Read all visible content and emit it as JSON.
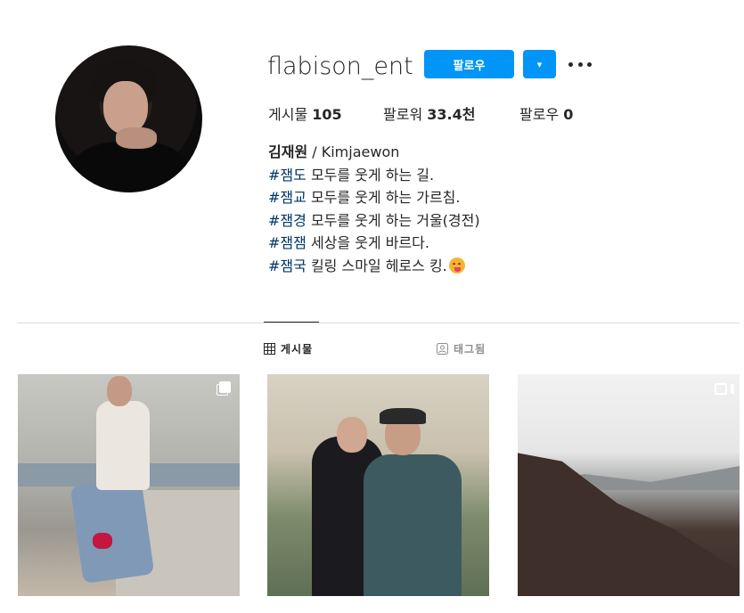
{
  "profile": {
    "username": "flabison_ent",
    "follow_label": "팔로우",
    "dropdown_label": "▾",
    "more_label": "더 보기"
  },
  "stats": {
    "posts_label": "게시물",
    "posts_count": "105",
    "followers_label": "팔로워",
    "followers_count": "33.4천",
    "following_label": "팔로우",
    "following_count": "0"
  },
  "bio": {
    "name": "김재원",
    "name_suffix": " / Kimjaewon",
    "lines": [
      {
        "tag": "#잼도",
        "text": " 모두를 웃게 하는 길."
      },
      {
        "tag": "#잼교",
        "text": " 모두를 웃게 하는 가르침."
      },
      {
        "tag": "#잼경",
        "text": " 모두를 웃게 하는 거울(경전)"
      },
      {
        "tag": "#잼잼",
        "text": " 세상을 웃게 바르다."
      },
      {
        "tag": "#잼국",
        "text": " 킬링 스마일 헤로스 킹."
      }
    ],
    "emoji": "savoring-food-face-emoji"
  },
  "tabs": [
    {
      "label": "게시물",
      "icon": "grid-icon",
      "active": true
    },
    {
      "label": "태그됨",
      "icon": "tagged-icon",
      "active": false
    }
  ],
  "posts": [
    {
      "description": "man in white jacket sitting on rooftop",
      "badge": "multiple-photos-icon"
    },
    {
      "description": "two men posing in front of poster",
      "badge": ""
    },
    {
      "description": "mountain landscape view",
      "badge": "video-icon"
    }
  ],
  "colors": {
    "accent": "#0095f6",
    "hashtag": "#00376b",
    "text": "#262626",
    "muted": "#8e8e8e",
    "divider": "#dbdbdb"
  }
}
